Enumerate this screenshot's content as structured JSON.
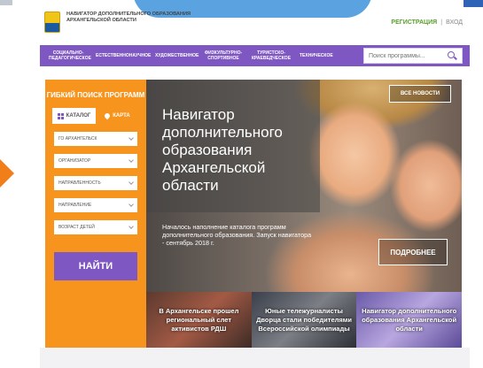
{
  "header": {
    "logo_text": "Навигатор дополнительного образования Архангельской области",
    "register_label": "РЕГИСТРАЦИЯ",
    "separator": "|",
    "login_label": "ВХОД"
  },
  "nav": {
    "items": [
      "СОЦИАЛЬНО-ПЕДАГОГИЧЕСКОЕ",
      "ЕСТЕСТВЕННОНАУЧНОЕ",
      "ХУДОЖЕСТВЕННОЕ",
      "ФИЗКУЛЬТУРНО-СПОРТИВНОЕ",
      "ТУРИСТСКО-КРАЕВЕДЧЕСКОЕ",
      "ТЕХНИЧЕСКОЕ"
    ],
    "search_placeholder": "Поиск программы..."
  },
  "panel": {
    "title": "ГИБКИЙ ПОИСК ПРОГРАММ",
    "tab_catalog": "КАТАЛОГ",
    "tab_map": "КАРТА",
    "filters": [
      "ГО АРХАНГЕЛЬСК",
      "ОРГАНИЗАТОР",
      "НАПРАВЛЕННОСТЬ",
      "НАПРАВЛЕНИЕ",
      "ВОЗРАСТ ДЕТЕЙ"
    ],
    "find_label": "НАЙТИ"
  },
  "hero": {
    "title": "Навигатор дополнительного образования Архангельской области",
    "text": "Началось наполнение каталога программ дополнительного образования. Запуск навигатора - сентябрь 2018 г.",
    "all_news_label": "ВСЕ НОВОСТИ",
    "more_label": "ПОДРОБНЕЕ"
  },
  "news": [
    "В Архангельске прошел региональный слет активистов РДШ",
    "Юные тележурналисты Дворца стали победителями Всероссийской олимпиады",
    "Навигатор дополнительного образования Архангельской области"
  ],
  "colors": {
    "brand_purple": "#7e57c2",
    "accent_orange": "#f7941d",
    "register_green": "#5aa02c"
  }
}
